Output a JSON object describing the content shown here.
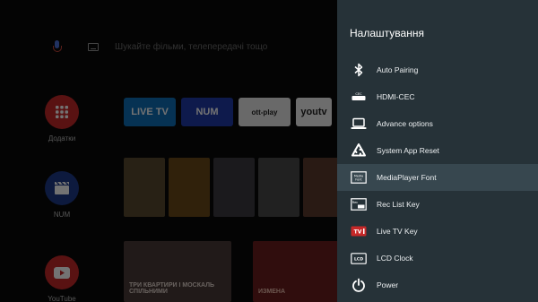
{
  "launcher": {
    "search_placeholder": "Шукайте фільми, телепередачі тощо",
    "apps": [
      {
        "label": "Додатки"
      },
      {
        "label": "NUM"
      },
      {
        "label": "YouTube"
      }
    ],
    "channels": [
      "LIVE TV",
      "NUM",
      "ott-play",
      "youtv"
    ],
    "bottom_captions": [
      "ТРИ КВАРТИРИ І МОСКАЛЬ СПІЛЬНИМИ",
      "ИЗМЕНА"
    ]
  },
  "settings": {
    "title": "Налаштування",
    "items": [
      {
        "label": "Auto Pairing",
        "icon": "bluetooth-icon"
      },
      {
        "label": "HDMI-CEC",
        "icon": "cec-icon"
      },
      {
        "label": "Advance options",
        "icon": "laptop-icon"
      },
      {
        "label": "System App Reset",
        "icon": "recycle-icon"
      },
      {
        "label": "MediaPlayer Font",
        "icon": "mediaplayer-font-icon"
      },
      {
        "label": "Rec List Key",
        "icon": "rec-list-icon"
      },
      {
        "label": "Live TV Key",
        "icon": "live-tv-icon"
      },
      {
        "label": "LCD Clock",
        "icon": "lcd-clock-icon"
      },
      {
        "label": "Power",
        "icon": "power-icon"
      }
    ],
    "selected_index": 4
  },
  "colors": {
    "panel_bg": "#263238",
    "selected_bg": "#37474f",
    "accent_red": "#c62828"
  }
}
